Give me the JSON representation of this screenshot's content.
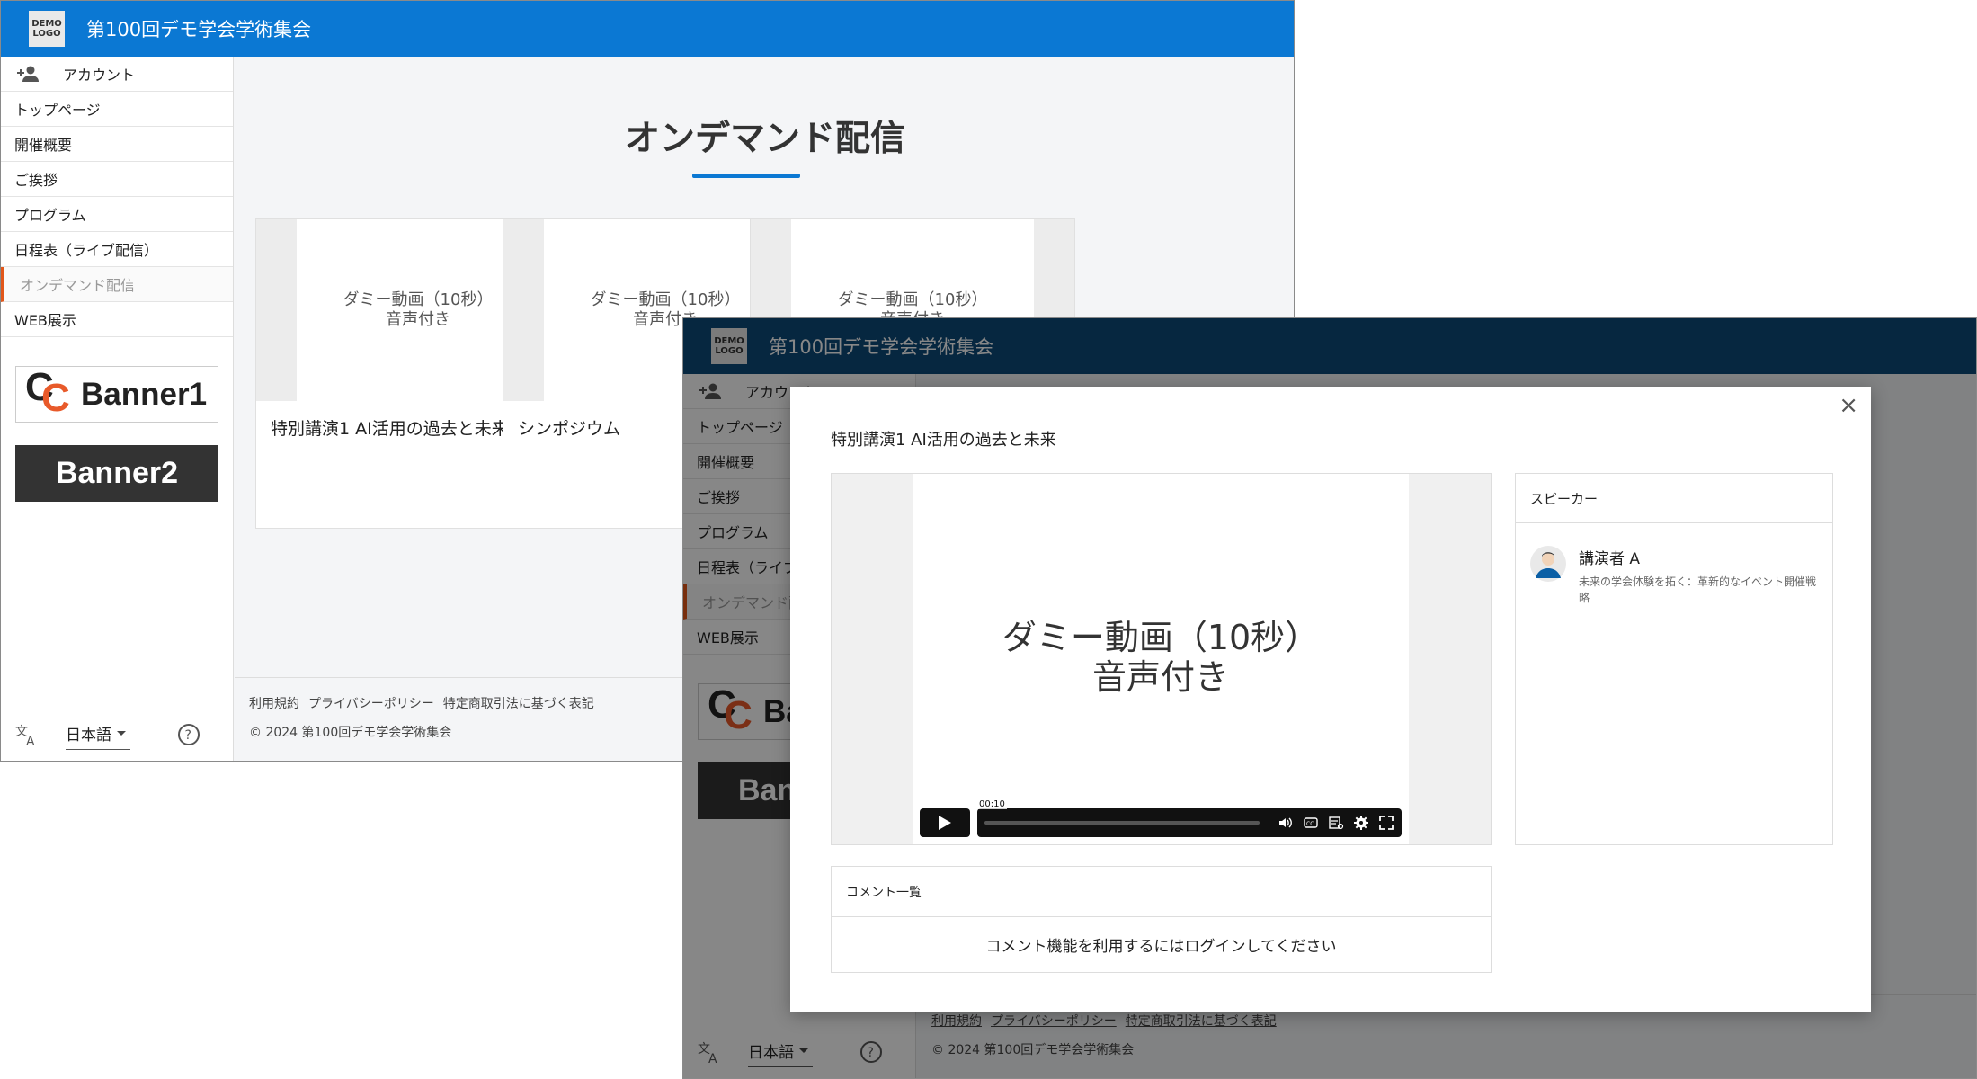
{
  "site": {
    "logo_line1": "DEMO",
    "logo_line2": "LOGO",
    "title": "第100回デモ学会学術集会"
  },
  "sidebar": {
    "account": "アカウント",
    "items": [
      "トップページ",
      "開催概要",
      "ご挨拶",
      "プログラム",
      "日程表（ライブ配信）",
      "オンデマンド配信",
      "WEB展示"
    ],
    "active_index": 5,
    "banner1_label": "Banner1",
    "banner2_label": "Banner2"
  },
  "language": {
    "selected": "日本語"
  },
  "main": {
    "page_title": "オンデマンド配信",
    "cards": [
      {
        "thumb_line1": "ダミー動画（10秒）",
        "thumb_line2": "音声付き",
        "title": "特別講演1 AI活用の過去と未来"
      },
      {
        "thumb_line1": "ダミー動画（10秒）",
        "thumb_line2": "音声付き",
        "title": "シンポジウム"
      },
      {
        "thumb_line1": "ダミー動画（10秒）",
        "thumb_line2": "音声付き",
        "title": ""
      }
    ]
  },
  "footer": {
    "links": [
      "利用規約",
      "プライバシーポリシー",
      "特定商取引法に基づく表記"
    ],
    "copyright": "© 2024 第100回デモ学会学術集会"
  },
  "modal": {
    "close": "×",
    "title": "特別講演1 AI活用の過去と未来",
    "video_line1": "ダミー動画（10秒）",
    "video_line2": "音声付き",
    "time": "00:10",
    "speaker_heading": "スピーカー",
    "speaker_name": "講演者 A",
    "speaker_desc": "未来の学会体験を拓く：革新的なイベント開催戦略",
    "comments_heading": "コメント一覧",
    "comments_login": "コメント機能を利用するにはログインしてください"
  },
  "colors": {
    "header_blue": "#0b78d3",
    "header_dimmed": "#0c4a7a",
    "active_accent": "#e2571a"
  }
}
